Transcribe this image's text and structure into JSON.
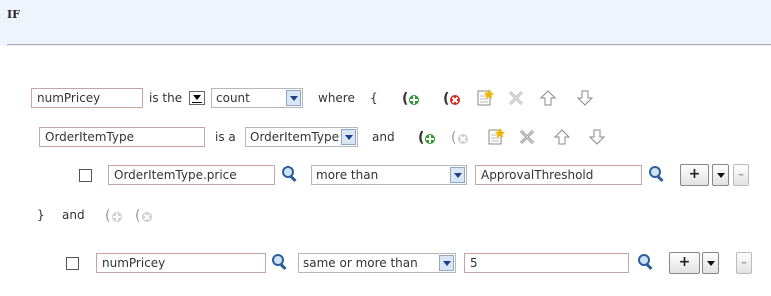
{
  "header": {
    "title": "IF"
  },
  "row1": {
    "var_value": "numPricey",
    "is_the": "is the",
    "func_value": "count",
    "where": "where",
    "open_brace": "{"
  },
  "row2": {
    "type_value": "OrderItemType",
    "is_a": "is a",
    "type_select": "OrderItemType",
    "and": "and"
  },
  "row3": {
    "field_value": "OrderItemType.price",
    "operator": "more than",
    "compare_value": "ApprovalThreshold",
    "plus_label": "+",
    "minus_label": "–"
  },
  "row4": {
    "close_brace": "}",
    "and": "and"
  },
  "row5": {
    "field_value": "numPricey",
    "operator": "same or more than",
    "compare_value": "5",
    "plus_label": "+",
    "minus_label": "–"
  },
  "icons": {
    "add_group": "add-group-icon",
    "remove_group": "remove-group-icon",
    "add_test": "add-test-icon",
    "delete": "delete-icon",
    "move_up": "arrow-up-icon",
    "move_down": "arrow-down-icon",
    "search": "magnifier-icon"
  },
  "colors": {
    "header_bg": "#eef4fb",
    "field_border": "#c9a4a4",
    "accent_green": "#2e9b2e",
    "accent_red": "#d22a1e"
  }
}
